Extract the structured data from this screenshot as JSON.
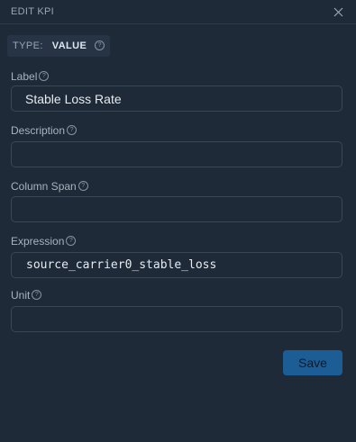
{
  "header": {
    "title": "EDIT KPI",
    "close_icon": "close-icon"
  },
  "type_badge": {
    "key": "TYPE:",
    "value": "VALUE",
    "help_icon": "?"
  },
  "fields": [
    {
      "label": "Label",
      "value": "Stable Loss Rate",
      "help_icon": "?"
    },
    {
      "label": "Description",
      "value": "",
      "help_icon": "?"
    },
    {
      "label": "Column Span",
      "value": "",
      "help_icon": "?"
    },
    {
      "label": "Expression",
      "value": "source_carrier0_stable_loss",
      "help_icon": "?"
    },
    {
      "label": "Unit",
      "value": "",
      "help_icon": "?"
    }
  ],
  "actions": {
    "save_label": "Save"
  },
  "colors": {
    "background": "#1e2a38",
    "accent": "#1d5d96",
    "border": "#3a4757"
  }
}
